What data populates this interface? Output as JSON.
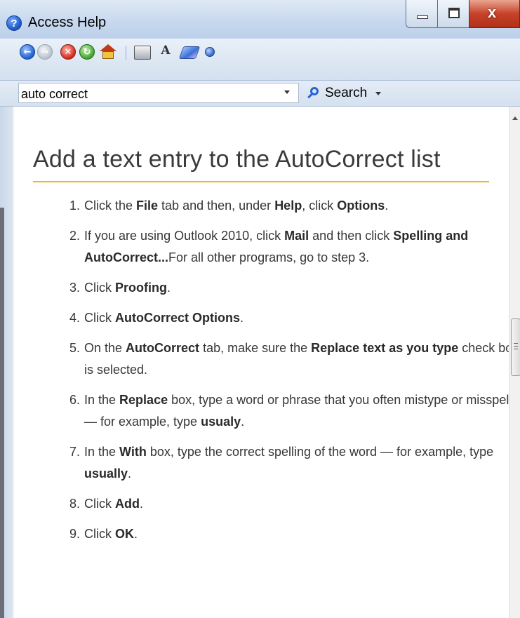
{
  "window": {
    "title": "Access Help",
    "help_glyph": "?",
    "close_glyph": "x"
  },
  "toolbar": {
    "icons": [
      "back-icon",
      "forward-icon",
      "stop-icon",
      "refresh-icon",
      "home-icon",
      "print-icon",
      "font-size-icon",
      "book-icon",
      "pin-icon"
    ],
    "back_glyph": "←",
    "forward_glyph": "→",
    "stop_glyph": "✕",
    "refresh_glyph": "↻",
    "font_glyph": "A",
    "search_value": "auto correct",
    "search_label": "Search"
  },
  "article": {
    "title": "Add a text entry to the AutoCorrect list",
    "steps": [
      {
        "num": "1.",
        "parts": [
          [
            "t",
            "Click the "
          ],
          [
            "b",
            "File"
          ],
          [
            "t",
            " tab and then, under "
          ],
          [
            "b",
            "Help"
          ],
          [
            "t",
            ", click "
          ],
          [
            "b",
            "Options"
          ],
          [
            "t",
            "."
          ]
        ]
      },
      {
        "num": "2.",
        "parts": [
          [
            "t",
            "If you are using Outlook 2010, click "
          ],
          [
            "b",
            "Mail"
          ],
          [
            "t",
            " and then click "
          ],
          [
            "b",
            "Spelling and AutoCorrect..."
          ],
          [
            "t",
            "For all other programs, go to step 3."
          ]
        ]
      },
      {
        "num": "3.",
        "parts": [
          [
            "t",
            "Click "
          ],
          [
            "b",
            "Proofing"
          ],
          [
            "t",
            "."
          ]
        ]
      },
      {
        "num": "4.",
        "parts": [
          [
            "t",
            "Click "
          ],
          [
            "b",
            "AutoCorrect Options"
          ],
          [
            "t",
            "."
          ]
        ]
      },
      {
        "num": "5.",
        "parts": [
          [
            "t",
            "On the "
          ],
          [
            "b",
            "AutoCorrect"
          ],
          [
            "t",
            " tab, make sure the "
          ],
          [
            "b",
            "Replace text as you type"
          ],
          [
            "t",
            " check box is selected."
          ]
        ]
      },
      {
        "num": "6.",
        "parts": [
          [
            "t",
            "In the "
          ],
          [
            "b",
            "Replace"
          ],
          [
            "t",
            " box, type a word or phrase that you often mistype or misspell — for example, type "
          ],
          [
            "b",
            "usualy"
          ],
          [
            "t",
            "."
          ]
        ]
      },
      {
        "num": "7.",
        "parts": [
          [
            "t",
            "In the "
          ],
          [
            "b",
            "With"
          ],
          [
            "t",
            " box, type the correct spelling of the word — for example, type "
          ],
          [
            "b",
            "usually"
          ],
          [
            "t",
            "."
          ]
        ]
      },
      {
        "num": "8.",
        "parts": [
          [
            "t",
            "Click "
          ],
          [
            "b",
            "Add"
          ],
          [
            "t",
            "."
          ]
        ]
      },
      {
        "num": "9.",
        "parts": [
          [
            "t",
            "Click "
          ],
          [
            "b",
            "OK"
          ],
          [
            "t",
            "."
          ]
        ]
      }
    ]
  },
  "colors": {
    "title_rule": "#f0b81a",
    "accent_blue": "#2a62d6",
    "close_red": "#c7422a"
  }
}
